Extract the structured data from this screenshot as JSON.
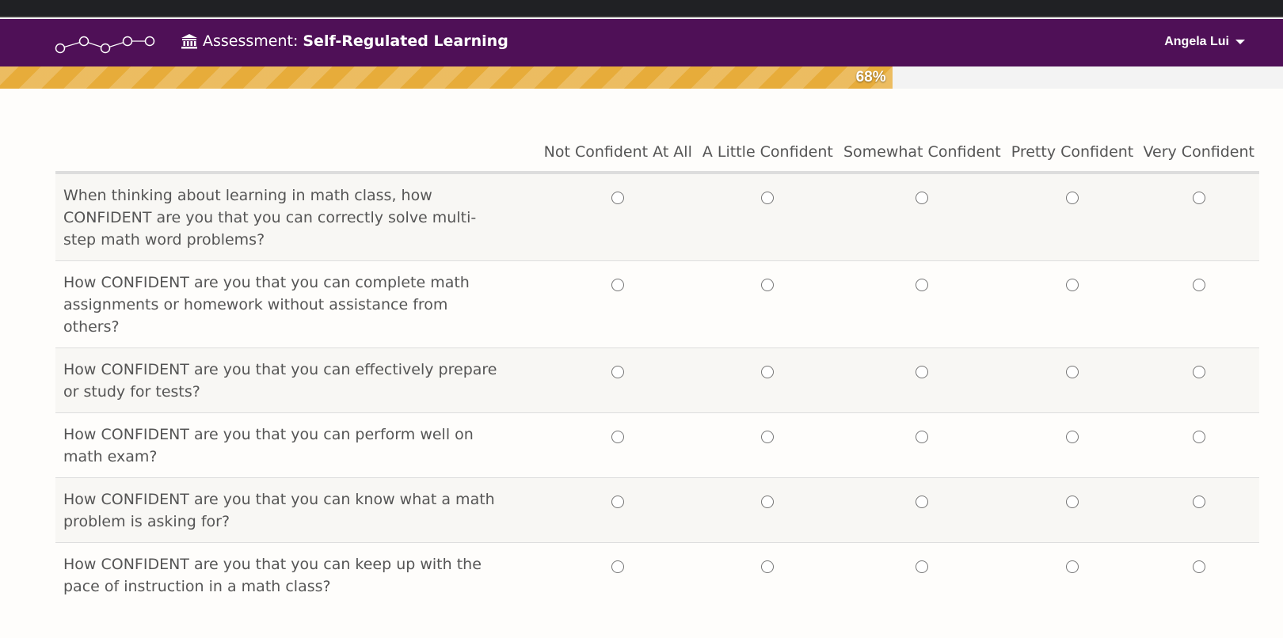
{
  "header": {
    "title_prefix": "Assessment:",
    "title_bold": "Self-Regulated Learning",
    "user_name": "Angela Lui",
    "brand_color": "#4f1057"
  },
  "progress": {
    "percent": 68,
    "label": "68%",
    "color": "#e7ac3a"
  },
  "scale": [
    "Not Confident At All",
    "A Little Confident",
    "Somewhat Confident",
    "Pretty Confident",
    "Very Confident"
  ],
  "questions": [
    "When thinking about learning in math class, how CONFIDENT are you that you can correctly solve multi-step math word problems?",
    "How CONFIDENT are you that you can complete math assignments or homework without assistance from others?",
    "How CONFIDENT are you that you can effectively prepare or study for tests?",
    "How CONFIDENT are you that you can perform well on math exam?",
    "How CONFIDENT are you that you can know what a math problem is asking for?",
    "How CONFIDENT are you that you can keep up with the pace of instruction in a math class?"
  ],
  "icons": {
    "logo": "connected-circles-logo",
    "title": "bank-building-icon",
    "user_menu": "caret-down-icon",
    "option": "radio-button"
  }
}
